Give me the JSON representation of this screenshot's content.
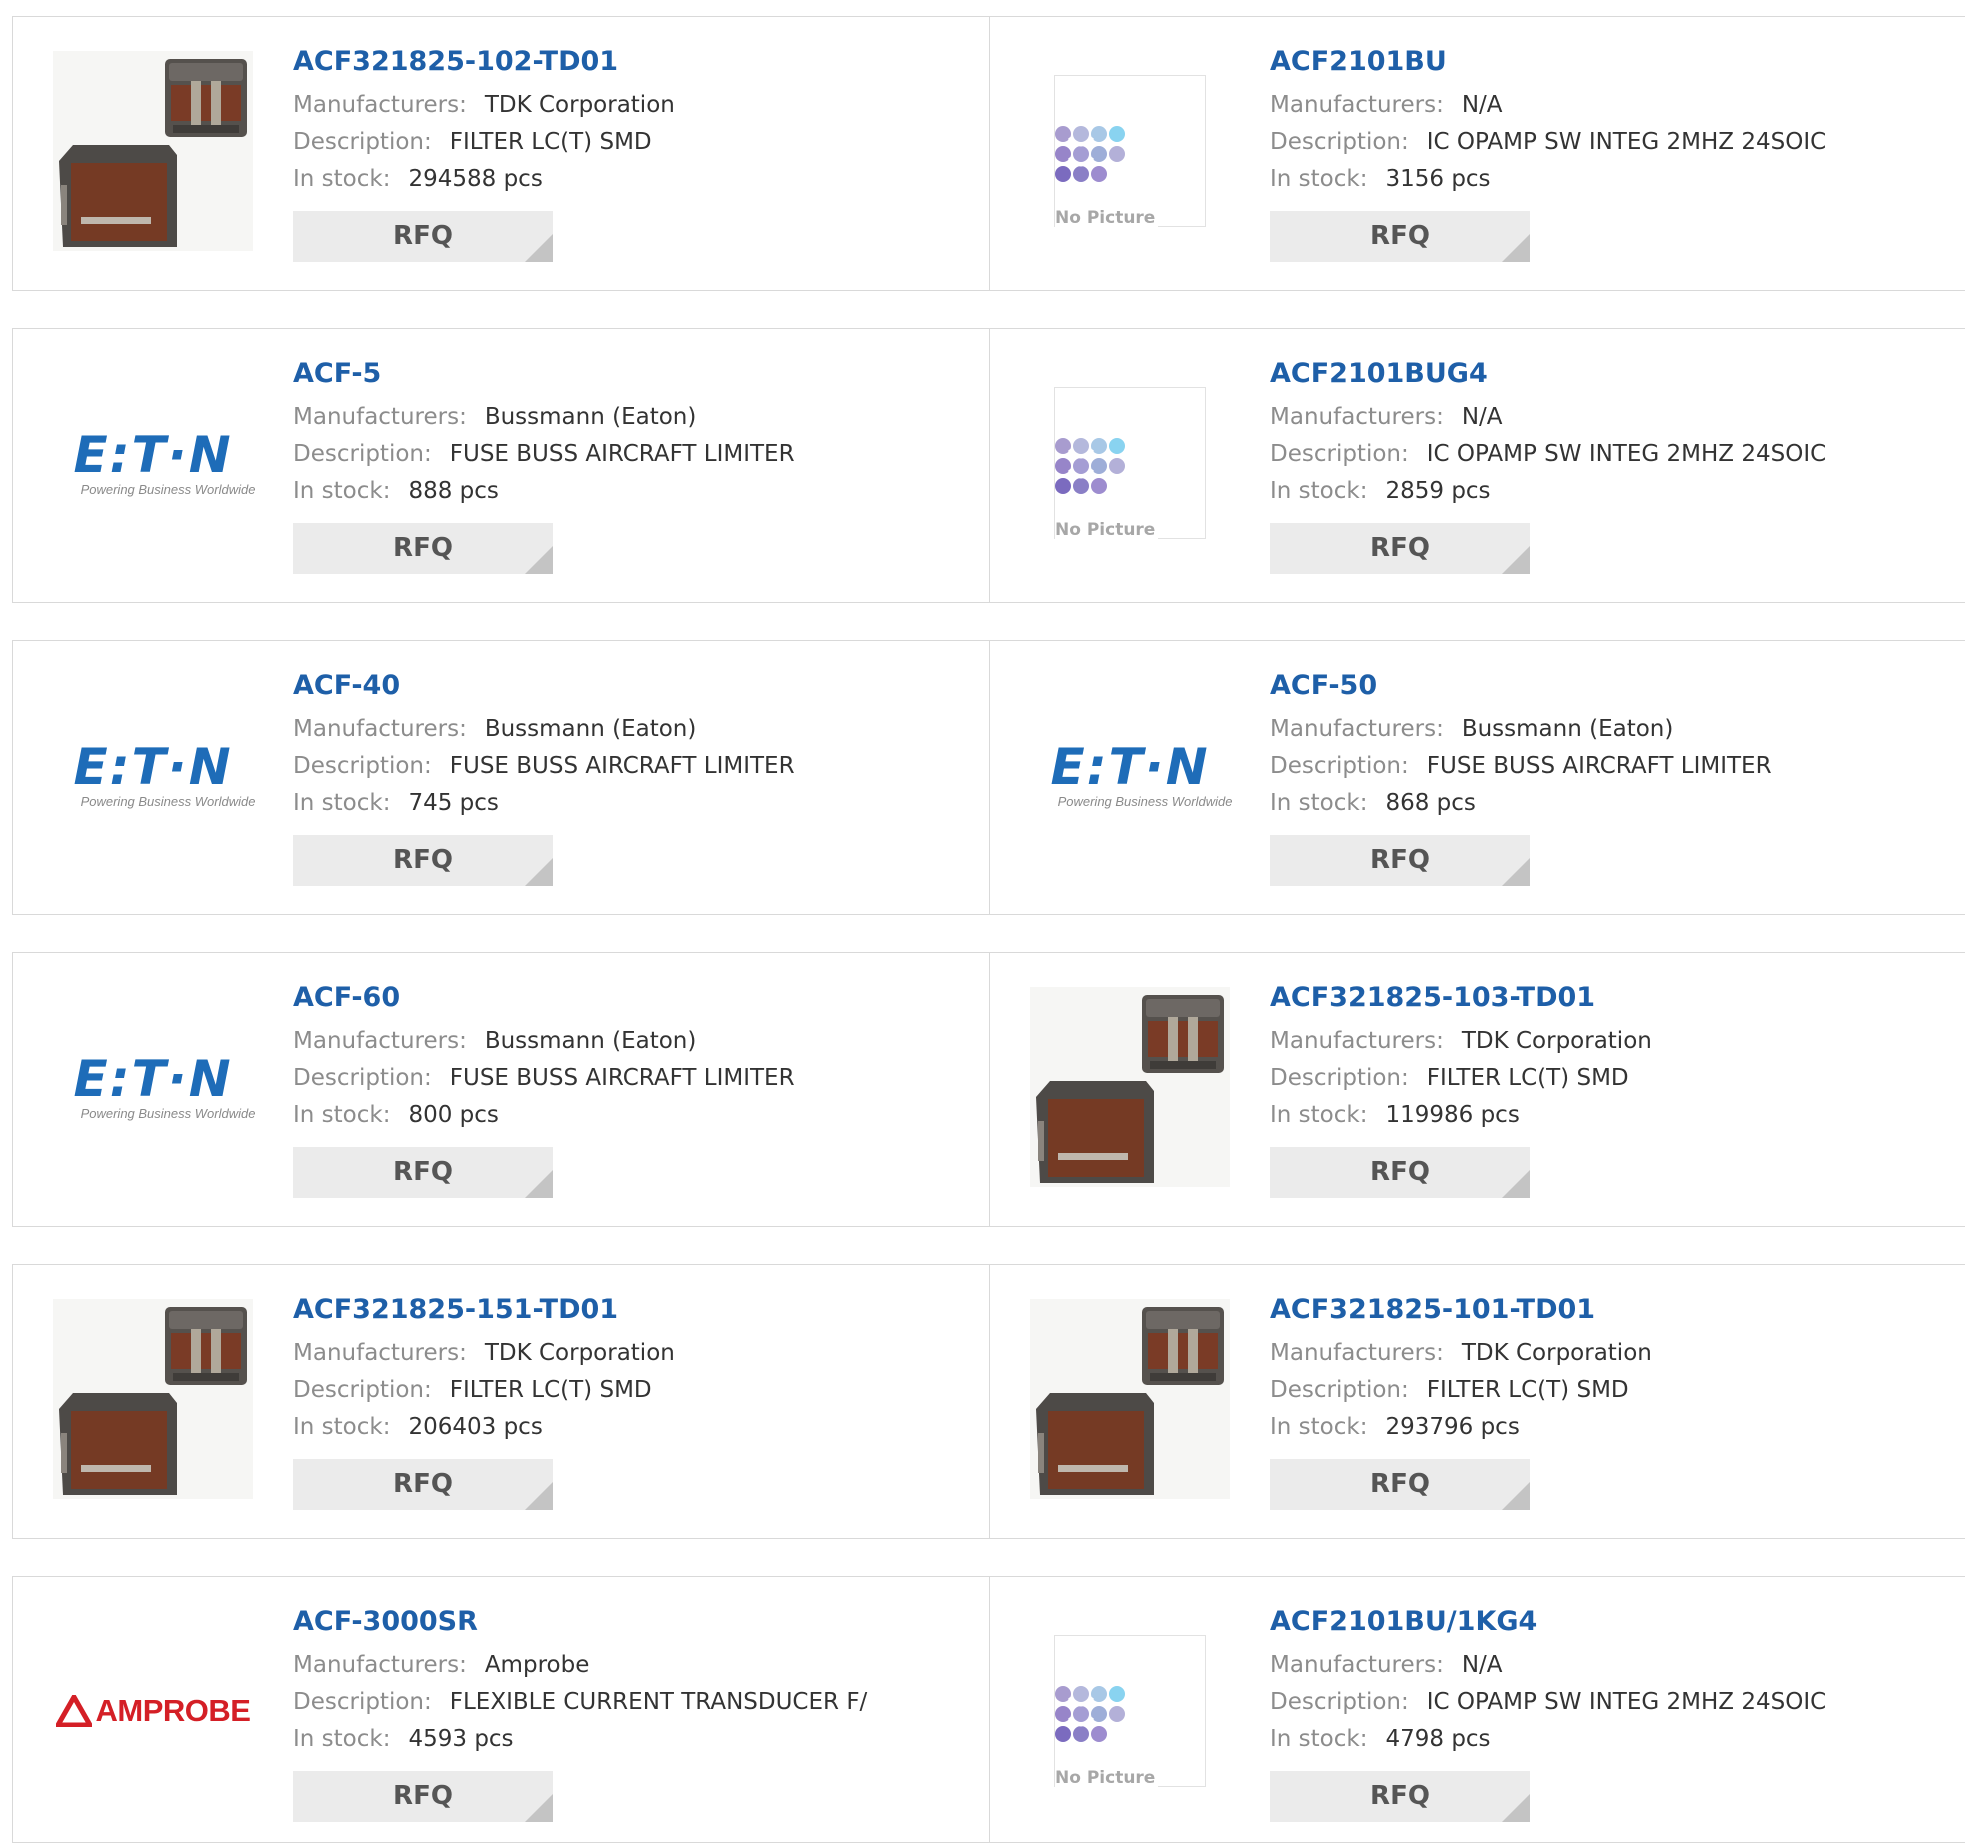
{
  "labels": {
    "manufacturers": "Manufacturers:",
    "description": "Description:",
    "in_stock": "In stock:",
    "rfq": "RFQ"
  },
  "logos": {
    "eaton_word": "E:T·N",
    "eaton_tagline": "Powering Business Worldwide",
    "amprobe_word": "AMPROBE",
    "no_picture": "No Picture"
  },
  "colors": {
    "part_link": "#1e5fa8",
    "rfq_button_bg": "#ebebeb",
    "eaton_blue": "#1e6cb8",
    "amprobe_red": "#d41f26"
  },
  "products": [
    {
      "part": "ACF321825-102-TD01",
      "manufacturer": "TDK Corporation",
      "description": "FILTER LC(T) SMD",
      "stock": "294588 pcs",
      "image": "tdk-filter-image"
    },
    {
      "part": "ACF2101BU",
      "manufacturer": "N/A",
      "description": "IC OPAMP SW INTEG 2MHZ 24SOIC",
      "stock": "3156 pcs",
      "image": "no-picture"
    },
    {
      "part": "ACF-5",
      "manufacturer": "Bussmann (Eaton)",
      "description": "FUSE BUSS AIRCRAFT LIMITER",
      "stock": "888 pcs",
      "image": "eaton-logo"
    },
    {
      "part": "ACF2101BUG4",
      "manufacturer": "N/A",
      "description": "IC OPAMP SW INTEG 2MHZ 24SOIC",
      "stock": "2859 pcs",
      "image": "no-picture"
    },
    {
      "part": "ACF-40",
      "manufacturer": "Bussmann (Eaton)",
      "description": "FUSE BUSS AIRCRAFT LIMITER",
      "stock": "745 pcs",
      "image": "eaton-logo"
    },
    {
      "part": "ACF-50",
      "manufacturer": "Bussmann (Eaton)",
      "description": "FUSE BUSS AIRCRAFT LIMITER",
      "stock": "868 pcs",
      "image": "eaton-logo"
    },
    {
      "part": "ACF-60",
      "manufacturer": "Bussmann (Eaton)",
      "description": "FUSE BUSS AIRCRAFT LIMITER",
      "stock": "800 pcs",
      "image": "eaton-logo"
    },
    {
      "part": "ACF321825-103-TD01",
      "manufacturer": "TDK Corporation",
      "description": "FILTER LC(T) SMD",
      "stock": "119986 pcs",
      "image": "tdk-filter-image"
    },
    {
      "part": "ACF321825-151-TD01",
      "manufacturer": "TDK Corporation",
      "description": "FILTER LC(T) SMD",
      "stock": "206403 pcs",
      "image": "tdk-filter-image"
    },
    {
      "part": "ACF321825-101-TD01",
      "manufacturer": "TDK Corporation",
      "description": "FILTER LC(T) SMD",
      "stock": "293796 pcs",
      "image": "tdk-filter-image"
    },
    {
      "part": "ACF-3000SR",
      "manufacturer": "Amprobe",
      "description": "FLEXIBLE CURRENT TRANSDUCER F/",
      "stock": "4593 pcs",
      "image": "amprobe-logo"
    },
    {
      "part": "ACF2101BU/1KG4",
      "manufacturer": "N/A",
      "description": "IC OPAMP SW INTEG 2MHZ 24SOIC",
      "stock": "4798 pcs",
      "image": "no-picture"
    }
  ]
}
